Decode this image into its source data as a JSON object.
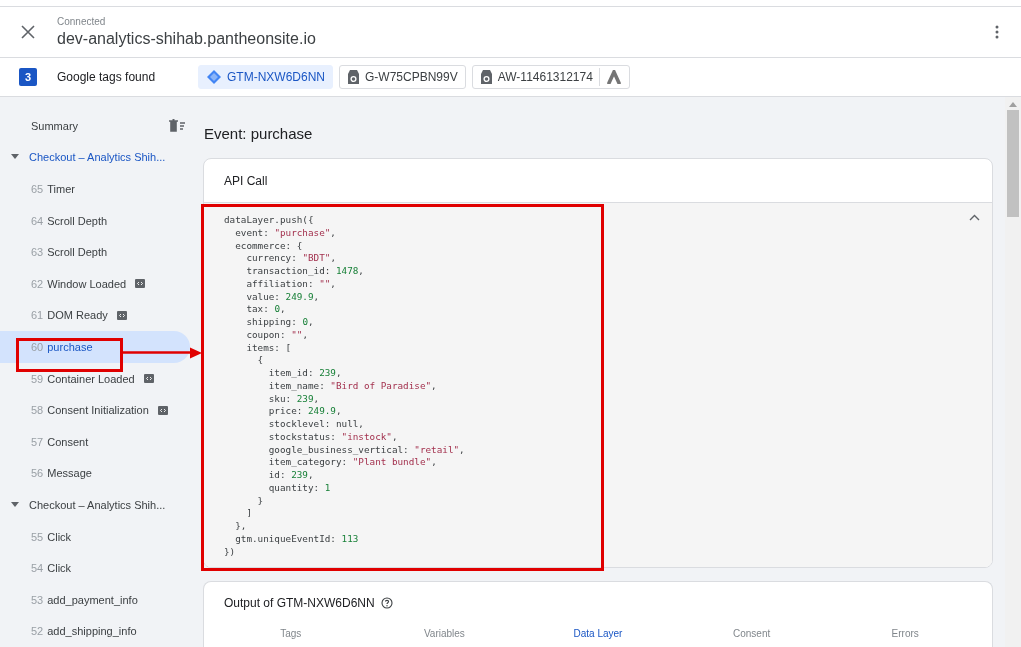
{
  "header": {
    "status": "Connected",
    "url": "dev-analytics-shihab.pantheonsite.io"
  },
  "tag_bar": {
    "count": "3",
    "label": "Google tags found",
    "tags": [
      {
        "label": "GTM-NXW6D6NN",
        "kind": "gtm",
        "selected": true
      },
      {
        "label": "G-W75CPBN99V",
        "kind": "ga",
        "selected": false
      },
      {
        "label": "AW-11461312174",
        "kind": "ads",
        "selected": false
      }
    ]
  },
  "sidebar": {
    "summary": "Summary",
    "groups": [
      {
        "label": "Checkout – Analytics Shih...",
        "expanded": true,
        "active": true,
        "children": [
          {
            "number": "65",
            "label": "Timer",
            "selected": false,
            "badge": false
          },
          {
            "number": "64",
            "label": "Scroll Depth",
            "selected": false,
            "badge": false
          },
          {
            "number": "63",
            "label": "Scroll Depth",
            "selected": false,
            "badge": false
          },
          {
            "number": "62",
            "label": "Window Loaded",
            "selected": false,
            "badge": true
          },
          {
            "number": "61",
            "label": "DOM Ready",
            "selected": false,
            "badge": true
          },
          {
            "number": "60",
            "label": "purchase",
            "selected": true,
            "badge": false
          },
          {
            "number": "59",
            "label": "Container Loaded",
            "selected": false,
            "badge": true
          },
          {
            "number": "58",
            "label": "Consent Initialization",
            "selected": false,
            "badge": true
          },
          {
            "number": "57",
            "label": "Consent",
            "selected": false,
            "badge": false
          },
          {
            "number": "56",
            "label": "Message",
            "selected": false,
            "badge": false
          }
        ]
      },
      {
        "label": "Checkout – Analytics Shih...",
        "expanded": true,
        "active": false,
        "children": [
          {
            "number": "55",
            "label": "Click",
            "selected": false,
            "badge": false
          },
          {
            "number": "54",
            "label": "Click",
            "selected": false,
            "badge": false
          },
          {
            "number": "53",
            "label": "add_payment_info",
            "selected": false,
            "badge": false
          },
          {
            "number": "52",
            "label": "add_shipping_info",
            "selected": false,
            "badge": false
          }
        ]
      }
    ]
  },
  "event_title": "Event: purchase",
  "api_call": {
    "title": "API Call",
    "expanded": true,
    "code_lines": [
      [
        {
          "t": "dataLayer.push({",
          "kind": "plain"
        }
      ],
      [
        {
          "t": "  event: ",
          "kind": "plain"
        },
        {
          "t": "\"purchase\"",
          "kind": "string"
        },
        {
          "t": ",",
          "kind": "plain"
        }
      ],
      [
        {
          "t": "  ecommerce: {",
          "kind": "plain"
        }
      ],
      [
        {
          "t": "    currency: ",
          "kind": "plain"
        },
        {
          "t": "\"BDT\"",
          "kind": "string"
        },
        {
          "t": ",",
          "kind": "plain"
        }
      ],
      [
        {
          "t": "    transaction_id: ",
          "kind": "plain"
        },
        {
          "t": "1478",
          "kind": "number"
        },
        {
          "t": ",",
          "kind": "plain"
        }
      ],
      [
        {
          "t": "    affiliation: ",
          "kind": "plain"
        },
        {
          "t": "\"\"",
          "kind": "string"
        },
        {
          "t": ",",
          "kind": "plain"
        }
      ],
      [
        {
          "t": "    value: ",
          "kind": "plain"
        },
        {
          "t": "249.9",
          "kind": "number"
        },
        {
          "t": ",",
          "kind": "plain"
        }
      ],
      [
        {
          "t": "    tax: ",
          "kind": "plain"
        },
        {
          "t": "0",
          "kind": "number"
        },
        {
          "t": ",",
          "kind": "plain"
        }
      ],
      [
        {
          "t": "    shipping: ",
          "kind": "plain"
        },
        {
          "t": "0",
          "kind": "number"
        },
        {
          "t": ",",
          "kind": "plain"
        }
      ],
      [
        {
          "t": "    coupon: ",
          "kind": "plain"
        },
        {
          "t": "\"\"",
          "kind": "string"
        },
        {
          "t": ",",
          "kind": "plain"
        }
      ],
      [
        {
          "t": "    items: [",
          "kind": "plain"
        }
      ],
      [
        {
          "t": "      {",
          "kind": "plain"
        }
      ],
      [
        {
          "t": "        item_id: ",
          "kind": "plain"
        },
        {
          "t": "239",
          "kind": "number"
        },
        {
          "t": ",",
          "kind": "plain"
        }
      ],
      [
        {
          "t": "        item_name: ",
          "kind": "plain"
        },
        {
          "t": "\"Bird of Paradise\"",
          "kind": "string"
        },
        {
          "t": ",",
          "kind": "plain"
        }
      ],
      [
        {
          "t": "        sku: ",
          "kind": "plain"
        },
        {
          "t": "239",
          "kind": "number"
        },
        {
          "t": ",",
          "kind": "plain"
        }
      ],
      [
        {
          "t": "        price: ",
          "kind": "plain"
        },
        {
          "t": "249.9",
          "kind": "number"
        },
        {
          "t": ",",
          "kind": "plain"
        }
      ],
      [
        {
          "t": "        stocklevel: null,",
          "kind": "plain"
        }
      ],
      [
        {
          "t": "        stockstatus: ",
          "kind": "plain"
        },
        {
          "t": "\"instock\"",
          "kind": "string"
        },
        {
          "t": ",",
          "kind": "plain"
        }
      ],
      [
        {
          "t": "        google_business_vertical: ",
          "kind": "plain"
        },
        {
          "t": "\"retail\"",
          "kind": "string"
        },
        {
          "t": ",",
          "kind": "plain"
        }
      ],
      [
        {
          "t": "        item_category: ",
          "kind": "plain"
        },
        {
          "t": "\"Plant bundle\"",
          "kind": "string"
        },
        {
          "t": ",",
          "kind": "plain"
        }
      ],
      [
        {
          "t": "        id: ",
          "kind": "plain"
        },
        {
          "t": "239",
          "kind": "number"
        },
        {
          "t": ",",
          "kind": "plain"
        }
      ],
      [
        {
          "t": "        quantity: ",
          "kind": "plain"
        },
        {
          "t": "1",
          "kind": "number"
        }
      ],
      [
        {
          "t": "      }",
          "kind": "plain"
        }
      ],
      [
        {
          "t": "    ]",
          "kind": "plain"
        }
      ],
      [
        {
          "t": "  },",
          "kind": "plain"
        }
      ],
      [
        {
          "t": "  gtm.uniqueEventId: ",
          "kind": "plain"
        },
        {
          "t": "113",
          "kind": "number"
        }
      ],
      [
        {
          "t": "})",
          "kind": "plain"
        }
      ]
    ]
  },
  "output": {
    "title": "Output of GTM-NXW6D6NN",
    "tabs": [
      {
        "label": "Tags",
        "selected": false
      },
      {
        "label": "Variables",
        "selected": false
      },
      {
        "label": "Data Layer",
        "selected": true
      },
      {
        "label": "Consent",
        "selected": false
      },
      {
        "label": "Errors",
        "selected": false
      }
    ]
  }
}
